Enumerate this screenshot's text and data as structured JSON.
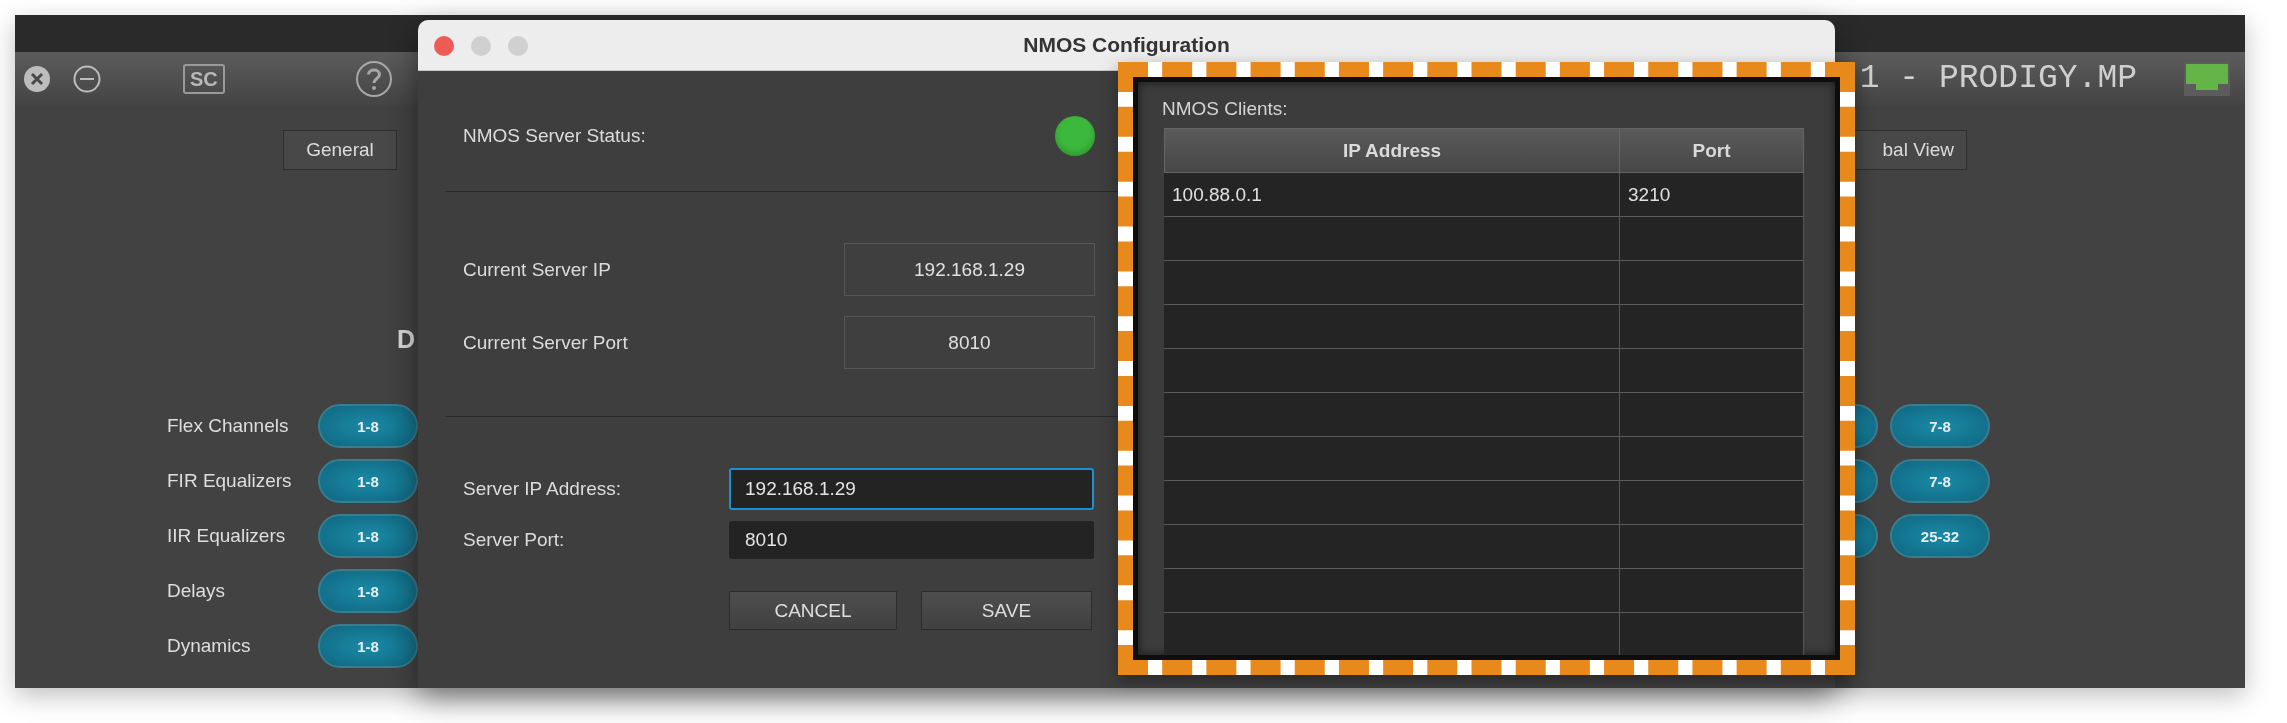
{
  "main_window": {
    "title": "1 - PRODIGY.MP",
    "sc_label": "SC",
    "tabs": [
      {
        "label": "General",
        "selected": false
      },
      {
        "label": "bal View",
        "selected": false
      }
    ],
    "heading": "D",
    "left_rows": [
      {
        "label": "Flex Channels",
        "range": "1-8"
      },
      {
        "label": "FIR Equalizers",
        "range": "1-8"
      },
      {
        "label": "IIR Equalizers",
        "range": "1-8"
      },
      {
        "label": "Delays",
        "range": "1-8"
      },
      {
        "label": "Dynamics",
        "range": "1-8"
      }
    ],
    "right_rows": [
      {
        "range": "7-8"
      },
      {
        "range": "7-8"
      },
      {
        "range": "25-32"
      }
    ]
  },
  "dialog": {
    "title": "NMOS Configuration",
    "status": {
      "label": "NMOS Server Status:",
      "on": true
    },
    "current": [
      {
        "label": "Current Server IP",
        "value": "192.168.1.29"
      },
      {
        "label": "Current Server Port",
        "value": "8010"
      }
    ],
    "fields": [
      {
        "label": "Server IP Address:",
        "value": "192.168.1.29",
        "focused": true
      },
      {
        "label": "Server Port:",
        "value": "8010",
        "focused": false
      }
    ],
    "buttons": [
      "CANCEL",
      "SAVE"
    ]
  },
  "clients": {
    "label": "NMOS Clients:",
    "columns": [
      "IP Address",
      "Port"
    ],
    "rows": [
      [
        "100.88.0.1",
        "3210"
      ]
    ]
  }
}
